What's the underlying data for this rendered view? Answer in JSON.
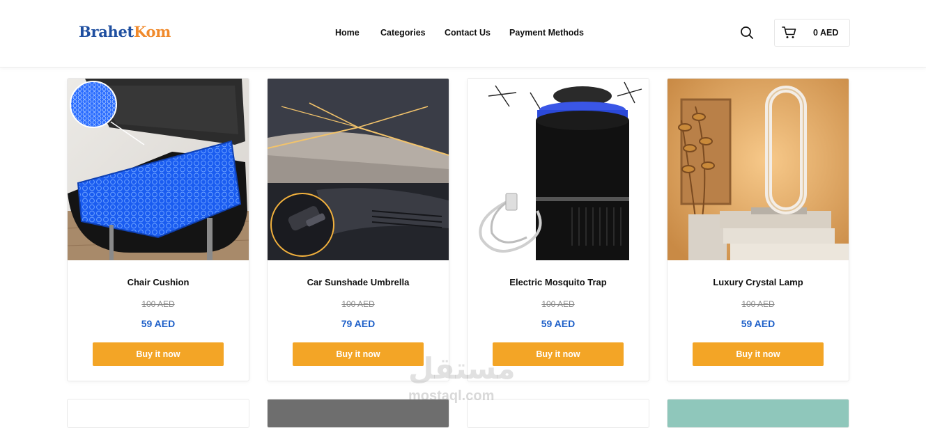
{
  "header": {
    "logo_part1": "Brahet",
    "logo_part2": "Kom",
    "nav": [
      "Home",
      "Categories",
      "Contact Us",
      "Payment Methods"
    ],
    "cart_total": "0 AED",
    "icons": {
      "search": "search-icon",
      "cart": "cart-icon"
    }
  },
  "products": [
    {
      "name": "Chair Cushion",
      "old_price": "100 AED",
      "price": "59 AED",
      "button": "Buy it now"
    },
    {
      "name": "Car Sunshade Umbrella",
      "old_price": "100 AED",
      "price": "79 AED",
      "button": "Buy it now"
    },
    {
      "name": "Electric Mosquito Trap",
      "old_price": "100 AED",
      "price": "59 AED",
      "button": "Buy it now"
    },
    {
      "name": "Luxury Crystal Lamp",
      "old_price": "100 AED",
      "price": "59 AED",
      "button": "Buy it now"
    }
  ],
  "watermark": {
    "arabic": "مستقل",
    "latin": "mostaql.com"
  },
  "colors": {
    "logo_blue": "#1f4fa0",
    "logo_orange": "#f08a2c",
    "price_blue": "#1d5fc8",
    "button_orange": "#f3a526"
  }
}
